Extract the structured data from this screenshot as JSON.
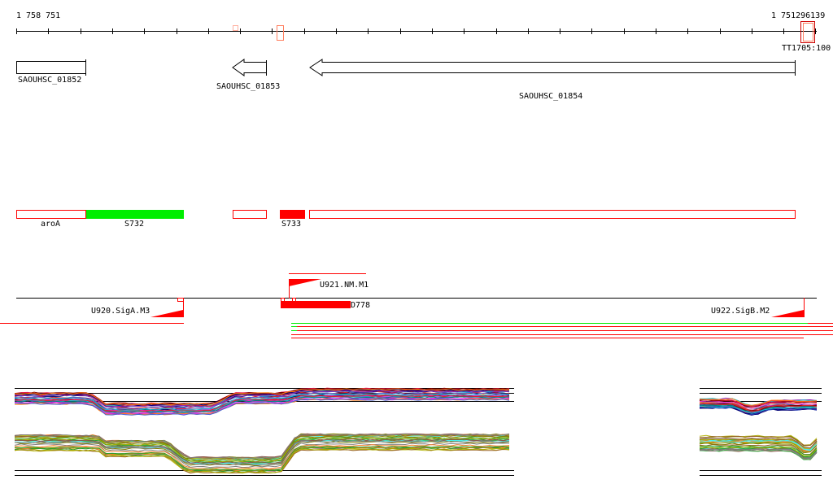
{
  "ruler": {
    "start_label": "1 758 751",
    "end_label": "1 751296139",
    "marker_label": "TT1705:100"
  },
  "genes": [
    {
      "name": "SAOUHSC_01852",
      "strand": "+"
    },
    {
      "name": "SAOUHSC_01853",
      "strand": "-"
    },
    {
      "name": "SAOUHSC_01854",
      "strand": "-"
    }
  ],
  "features": [
    {
      "name": "aroA",
      "style": "outline"
    },
    {
      "name": "S732",
      "style": "green-fill"
    },
    {
      "name": "",
      "style": "outline"
    },
    {
      "name": "S733",
      "style": "red-fill"
    },
    {
      "name": "",
      "style": "outline"
    }
  ],
  "promoters": [
    {
      "name": "U920.SigA.M3"
    },
    {
      "name": "U921.NM.M1"
    },
    {
      "name": "U922.SigB.M2"
    },
    {
      "name": "D778"
    }
  ],
  "colors": {
    "red": "#ff0000",
    "green": "#00ee00",
    "black": "#000000"
  }
}
